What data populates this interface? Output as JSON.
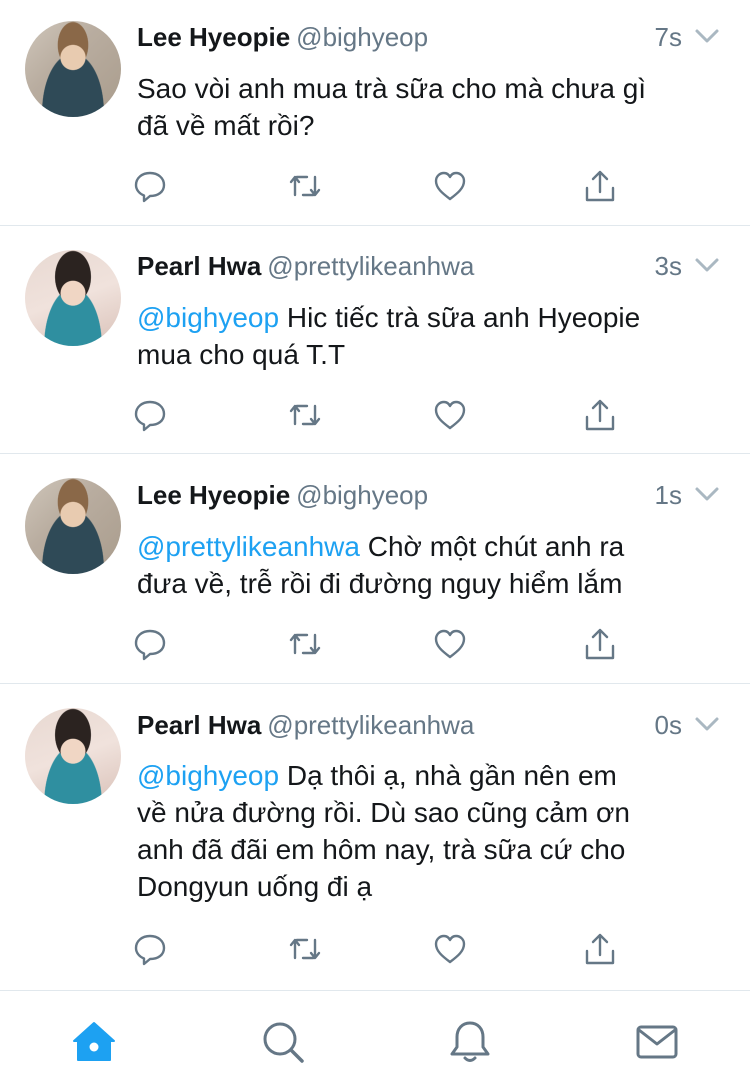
{
  "colors": {
    "accent": "#1da1f2",
    "text": "#14171a",
    "muted": "#657786",
    "divider": "#e1e8ed"
  },
  "tweets": [
    {
      "author": "Lee Hyeopie",
      "handle": "@bighyeop",
      "time": "7s",
      "mention": "",
      "text_lines": [
        "Sao vòi anh mua trà sữa cho mà chưa gì",
        "đã về mất rồi?"
      ]
    },
    {
      "author": "Pearl Hwa",
      "handle": "@prettylikeanhwa",
      "time": "3s",
      "mention": "@bighyeop",
      "text_lines": [
        " Hic tiếc trà sữa anh Hyeopie",
        "mua cho quá T.T"
      ]
    },
    {
      "author": "Lee Hyeopie",
      "handle": "@bighyeop",
      "time": "1s",
      "mention": "@prettylikeanhwa",
      "text_lines": [
        " Chờ một chút anh ra",
        "đưa về, trễ rồi đi đường nguy hiểm lắm"
      ]
    },
    {
      "author": "Pearl Hwa",
      "handle": "@prettylikeanhwa",
      "time": "0s",
      "mention": "@bighyeop",
      "text_lines": [
        " Dạ thôi ạ, nhà gần nên em",
        "về nửa đường rồi. Dù sao cũng cảm ơn",
        "anh đã đãi em hôm nay, trà sữa cứ cho",
        "Dongyun uống đi ạ"
      ]
    }
  ],
  "action_icons": [
    "reply-icon",
    "retweet-icon",
    "like-icon",
    "share-icon"
  ],
  "tab_icons": [
    "home-icon",
    "search-icon",
    "notifications-icon",
    "messages-icon"
  ],
  "active_tab": "home"
}
